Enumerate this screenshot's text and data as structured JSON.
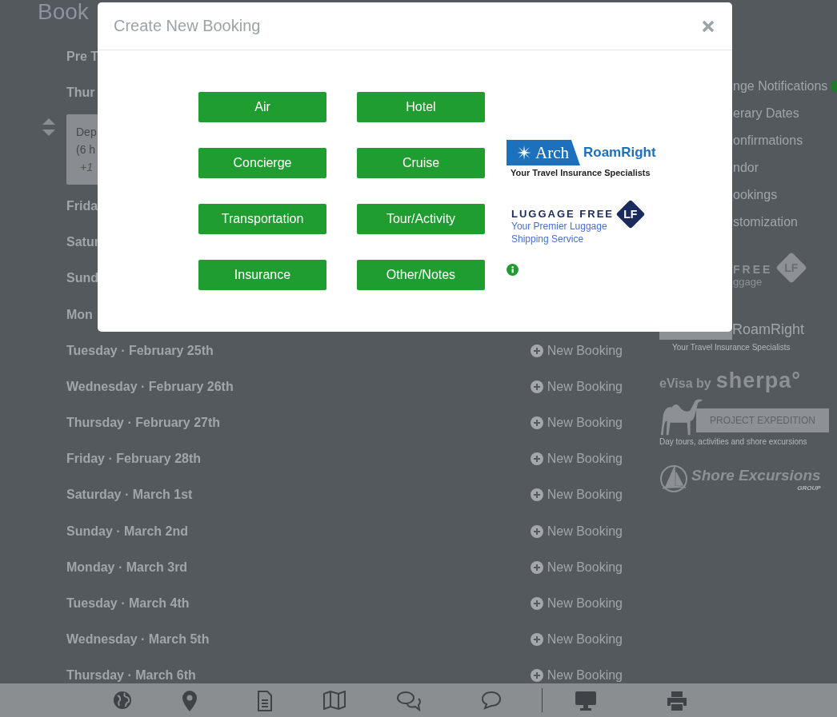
{
  "page_title": "Book",
  "itinerary": [
    {
      "kind": "day",
      "label": "Pre T"
    },
    {
      "kind": "day",
      "label": "Thur"
    },
    {
      "kind": "card",
      "lines": [
        "Dep",
        "(6 h",
        "+1"
      ]
    },
    {
      "kind": "day",
      "label": "Frida"
    },
    {
      "kind": "day",
      "label": "Satur"
    },
    {
      "kind": "day",
      "label": "Sund"
    },
    {
      "kind": "day",
      "label": "Mon"
    },
    {
      "kind": "day",
      "label": "Tuesday · February 25th",
      "action": "New Booking"
    },
    {
      "kind": "day",
      "label": "Wednesday · February 26th",
      "action": "New Booking"
    },
    {
      "kind": "day",
      "label": "Thursday · February 27th",
      "action": "New Booking"
    },
    {
      "kind": "day",
      "label": "Friday · February 28th",
      "action": "New Booking"
    },
    {
      "kind": "day",
      "label": "Saturday · March 1st",
      "action": "New Booking"
    },
    {
      "kind": "day",
      "label": "Sunday · March 2nd",
      "action": "New Booking"
    },
    {
      "kind": "day",
      "label": "Monday · March 3rd",
      "action": "New Booking"
    },
    {
      "kind": "day",
      "label": "Tuesday · March 4th",
      "action": "New Booking"
    },
    {
      "kind": "day",
      "label": "Wednesday · March 5th",
      "action": "New Booking"
    },
    {
      "kind": "day",
      "label": "Thursday · March 6th",
      "action": "New Booking"
    }
  ],
  "sidebar": {
    "items": [
      {
        "label": "nge Notifications",
        "badge": true
      },
      {
        "label": "erary Dates",
        "badge": false
      },
      {
        "label": "onfirmations",
        "badge": false
      },
      {
        "label": "ndor",
        "badge": false
      },
      {
        "label": "ookings",
        "badge": false
      },
      {
        "label": "stomization",
        "badge": false
      }
    ],
    "partners": [
      {
        "kind": "luggage_free",
        "name": "FREE",
        "tagline": "ggage",
        "badge": "LF"
      },
      {
        "kind": "roamright",
        "name": "RoamRight",
        "tagline": "Your Travel Insurance Specialists"
      },
      {
        "kind": "evisa",
        "prefix": "eVisa by",
        "name": "sherpa°"
      },
      {
        "kind": "project_expedition",
        "name": "PROJECT EXPEDITION",
        "tagline": "Day tours, activities and shore excursions"
      },
      {
        "kind": "shore_excursions",
        "name": "Shore Excursions",
        "suffix": "GROUP"
      }
    ]
  },
  "modal": {
    "title": "Create New Booking",
    "buttons": [
      "Air",
      "Hotel",
      "Concierge",
      "Cruise",
      "Transportation",
      "Tour/Activity",
      "Insurance",
      "Other/Notes"
    ],
    "partners": [
      {
        "kind": "roamright",
        "brand": "Arch",
        "name": "RoamRight",
        "tagline": "Your Travel Insurance Specialists"
      },
      {
        "kind": "luggage_free",
        "name": "LUGGAGE FREE",
        "tagline": "Your Premier Luggage Shipping Service",
        "badge": "LF"
      }
    ]
  }
}
